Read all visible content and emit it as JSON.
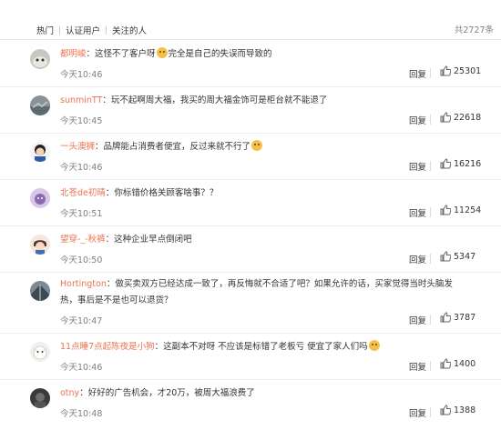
{
  "tabs": [
    "热门",
    "认证用户",
    "关注的人"
  ],
  "total_count": "共2727条",
  "reply_label": "回复",
  "comments": [
    {
      "user": "都明峻",
      "text_before": "：这怪不了客户呀",
      "emoji1": "laughing-tears",
      "text_after": "完全是自己的失误而导致的",
      "time": "今天10:46",
      "likes": "25301"
    },
    {
      "user": "sunminTT",
      "text": "：玩不起啊周大福，我买的周大福金饰可是柜台就不能退了",
      "time": "今天10:45",
      "likes": "22618"
    },
    {
      "user": "一头澳狮",
      "text_before": "：品牌能占消费者便宜，反过来就不行了",
      "emoji1": "laughing",
      "text_after": "",
      "time": "今天10:46",
      "likes": "16216"
    },
    {
      "user": "北苍de初晴",
      "text": "：你标错价格关顾客啥事？？",
      "time": "今天10:51",
      "likes": "11254"
    },
    {
      "user": "望穿-_-秋裤",
      "text": "：这种企业早点倒闭吧",
      "time": "今天10:50",
      "likes": "5347"
    },
    {
      "user": "Hortington",
      "text": "：做买卖双方已经达成一致了，再反悔就不合适了吧？如果允许的话，买家觉得当时头脑发热，事后是不是也可以退货？",
      "time": "今天10:47",
      "likes": "3787"
    },
    {
      "user": "11点睡7点起陈夜是小狗",
      "text_before": "：这副本不对呀 不应该是标错了老板亏 便宜了家人们吗",
      "emoji1": "happy",
      "text_after": "",
      "time": "今天10:46",
      "likes": "1400"
    },
    {
      "user": "otny",
      "text": "：好好的广告机会，才20万，被周大福浪费了",
      "time": "今天10:48",
      "likes": "1388"
    }
  ]
}
